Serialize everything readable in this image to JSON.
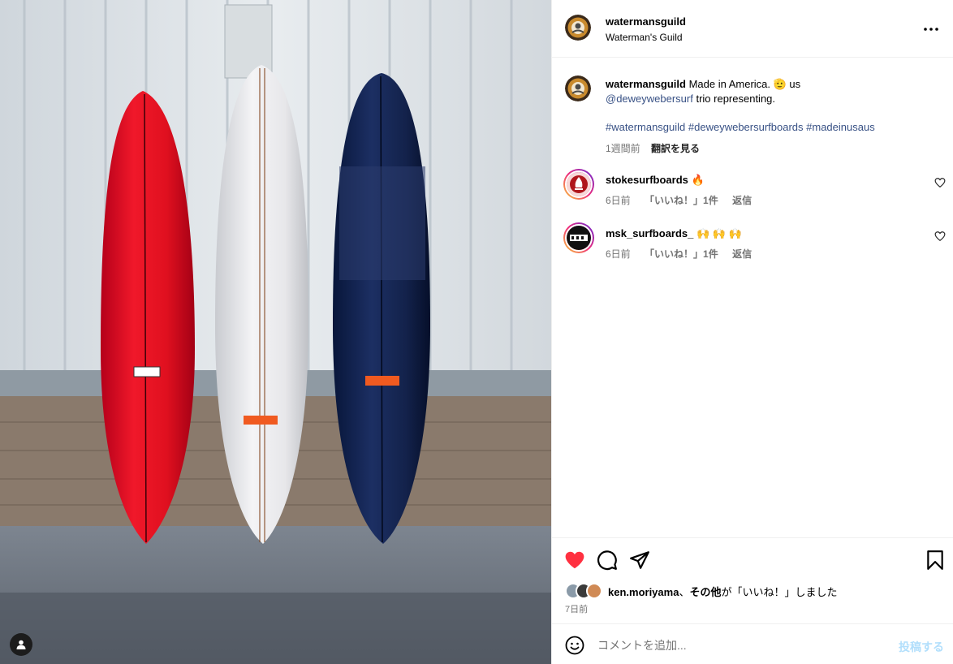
{
  "post": {
    "username": "watermansguild",
    "subtitle": "Waterman's Guild",
    "more_icon": "more-horizontal-icon"
  },
  "caption": {
    "username": "watermansguild",
    "text_1": " Made in America. ",
    "emoji": "🫡",
    "text_2": " us",
    "mention": "@deweywebersurf",
    "text_3": " trio representing.",
    "hashtags": "#watermansguild #deweywebersurfboards #madeinusaus",
    "time": "1週間前",
    "translate": "翻訳を見る"
  },
  "comments": [
    {
      "username": "stokesurfboards",
      "text": " 🔥",
      "time": "6日前",
      "likes": "「いいね！」1件",
      "reply": "返信"
    },
    {
      "username": "msk_surfboards_",
      "text": " 🙌 🙌 🙌",
      "time": "6日前",
      "likes": "「いいね！」1件",
      "reply": "返信"
    }
  ],
  "actions": {
    "like_icon": "heart-filled-icon",
    "comment_icon": "comment-icon",
    "share_icon": "send-icon",
    "save_icon": "bookmark-icon",
    "liked_by_user": "ken.moriyama",
    "liked_sep": "、",
    "liked_others": "その他",
    "liked_suffix": "が「いいね！」しました",
    "date": "7日前"
  },
  "add_comment": {
    "placeholder": "コメントを追加...",
    "post_label": "投稿する"
  },
  "colors": {
    "like_red": "#ff3040",
    "link_blue": "#385185",
    "post_disabled": "#b2dffc"
  }
}
